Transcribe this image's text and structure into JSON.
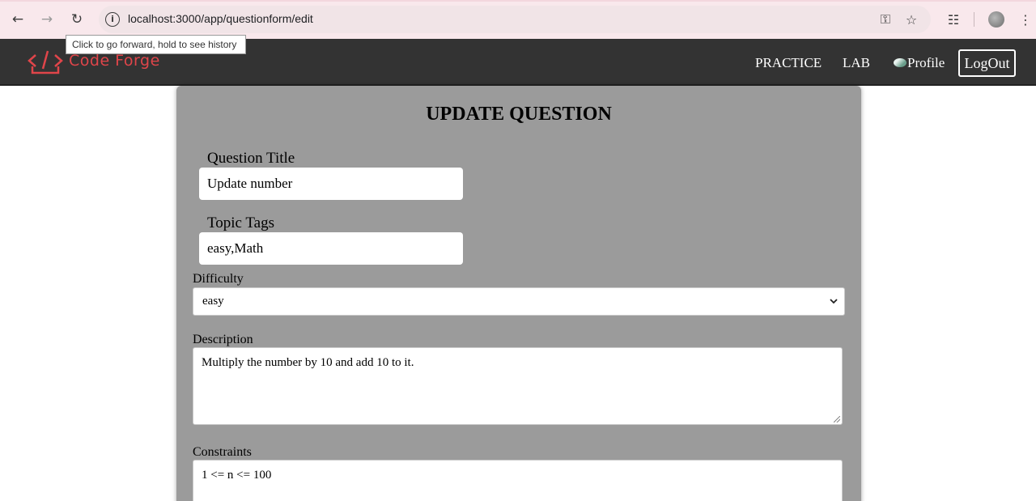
{
  "browser": {
    "url": "localhost:3000/app/questionform/edit",
    "tooltip": "Click to go forward, hold to see history"
  },
  "navbar": {
    "brand": "Code Forge",
    "links": [
      "PRACTICE",
      "LAB",
      "Profile"
    ],
    "logout_label": "LogOut",
    "colors": {
      "background": "#333333",
      "brand": "#e0454a"
    }
  },
  "form": {
    "title": "UPDATE QUESTION",
    "question_title_label": "Question Title",
    "question_title_value": "Update number",
    "topic_tags_label": "Topic Tags",
    "topic_tags_value": "easy,Math",
    "difficulty_label": "Difficulty",
    "difficulty_value": "easy",
    "description_label": "Description",
    "description_value": "Multiply the number by 10 and add 10 to it.",
    "constraints_label": "Constraints",
    "constraints_value": "1 <= n <= 100",
    "colors": {
      "card": "#9b9b9b"
    }
  }
}
